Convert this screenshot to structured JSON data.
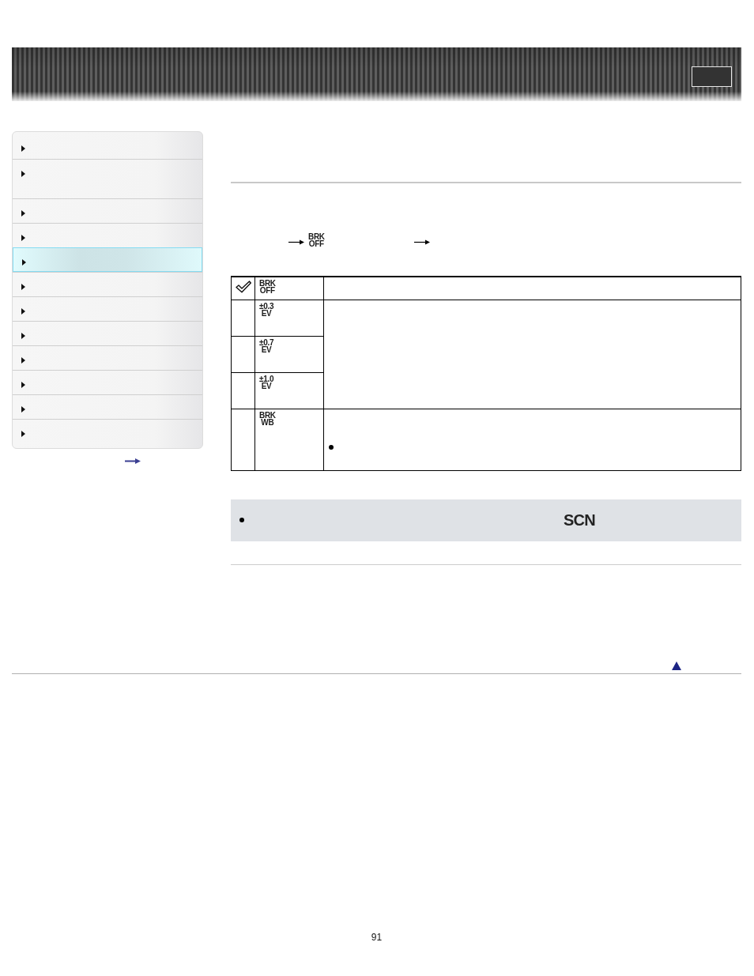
{
  "sidebar": {
    "items": [
      {
        "kind": "single",
        "selected": false
      },
      {
        "kind": "double",
        "selected": false
      },
      {
        "kind": "single",
        "selected": false
      },
      {
        "kind": "single",
        "selected": false
      },
      {
        "kind": "single",
        "selected": true
      },
      {
        "kind": "single",
        "selected": false
      },
      {
        "kind": "single",
        "selected": false
      },
      {
        "kind": "single",
        "selected": false
      },
      {
        "kind": "single",
        "selected": false
      },
      {
        "kind": "single",
        "selected": false
      },
      {
        "kind": "single",
        "selected": false
      },
      {
        "kind": "single",
        "selected": false
      }
    ]
  },
  "procedure": {
    "icon_label": "BRK\nOFF"
  },
  "table": {
    "groups": [
      {
        "bullet": false,
        "items": [
          {
            "checked": true,
            "label": "BRK\nOFF"
          }
        ]
      },
      {
        "bullet": false,
        "items": [
          {
            "checked": false,
            "label": "±0.3\nEV"
          },
          {
            "checked": false,
            "label": "±0.7\nEV"
          },
          {
            "checked": false,
            "label": "±1.0\nEV"
          }
        ]
      },
      {
        "bullet": true,
        "items": [
          {
            "checked": false,
            "label": "BRK\nWB"
          }
        ]
      }
    ]
  },
  "note": {
    "items": [
      {
        "label": "SCN"
      }
    ]
  },
  "page_number": "91"
}
